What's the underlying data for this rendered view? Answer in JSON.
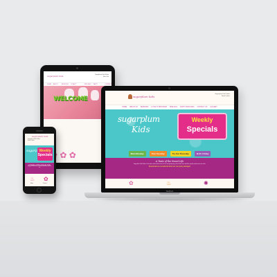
{
  "tablet": {
    "logo": "sugarplum kids",
    "contact": [
      "Sugarplum Kids Salon",
      "Mon–Sat"
    ],
    "nav": [
      "HOME",
      "ABOUT US",
      "SERVICES",
      "LOYALTY PROGRAM",
      "SPECIALS",
      "PARTY GALLERY",
      "CONTACT"
    ],
    "hero_text": "WELCOME"
  },
  "laptop": {
    "logo": "sugarplum kids",
    "contact": [
      "Sugarplum Kids Salon",
      "Book Online"
    ],
    "nav": [
      "HOME",
      "ABOUT US",
      "SERVICES",
      "LOYALTY PROGRAM",
      "SPECIALS",
      "PARTY PACKAGES",
      "CONTACT US",
      "GALLERY"
    ],
    "brand_line1": "sugarplum",
    "brand_line2": "Kids",
    "specials_line1": "Weekly",
    "specials_line2": "Specials",
    "buttons": [
      "Mani Monday",
      "Tutu Tuesday",
      "Try the Thursday",
      "B.F.F. Friday"
    ],
    "taste_heading": "A Taste of the Sweet Life",
    "body_text": "Sugarplum Kids Salon is the place where kids come for fun and pampering, where little ones feel like royalty and parents can relax.",
    "highlight": "Special ask our receptionist about our new party packages!",
    "laptop_brand": "MacBook"
  },
  "phone": {
    "logo": "sugarplum kids",
    "contact": [
      "Sugarplum Kids Salon",
      "Book Online"
    ],
    "brand": "sugarplum Kids",
    "specials_line1": "Weekly",
    "specials_line2": "Specials",
    "taste_heading": "A Taste of the Sweet Life",
    "body_text": "Sugarplum Kids Salon is the place where kids come for fun.",
    "icon_captions": [
      "Mani",
      "Parties"
    ]
  },
  "colors": {
    "teal": "#4cc7c9",
    "magenta": "#e42d88",
    "purple": "#a52884",
    "yellow": "#ffe23b"
  }
}
